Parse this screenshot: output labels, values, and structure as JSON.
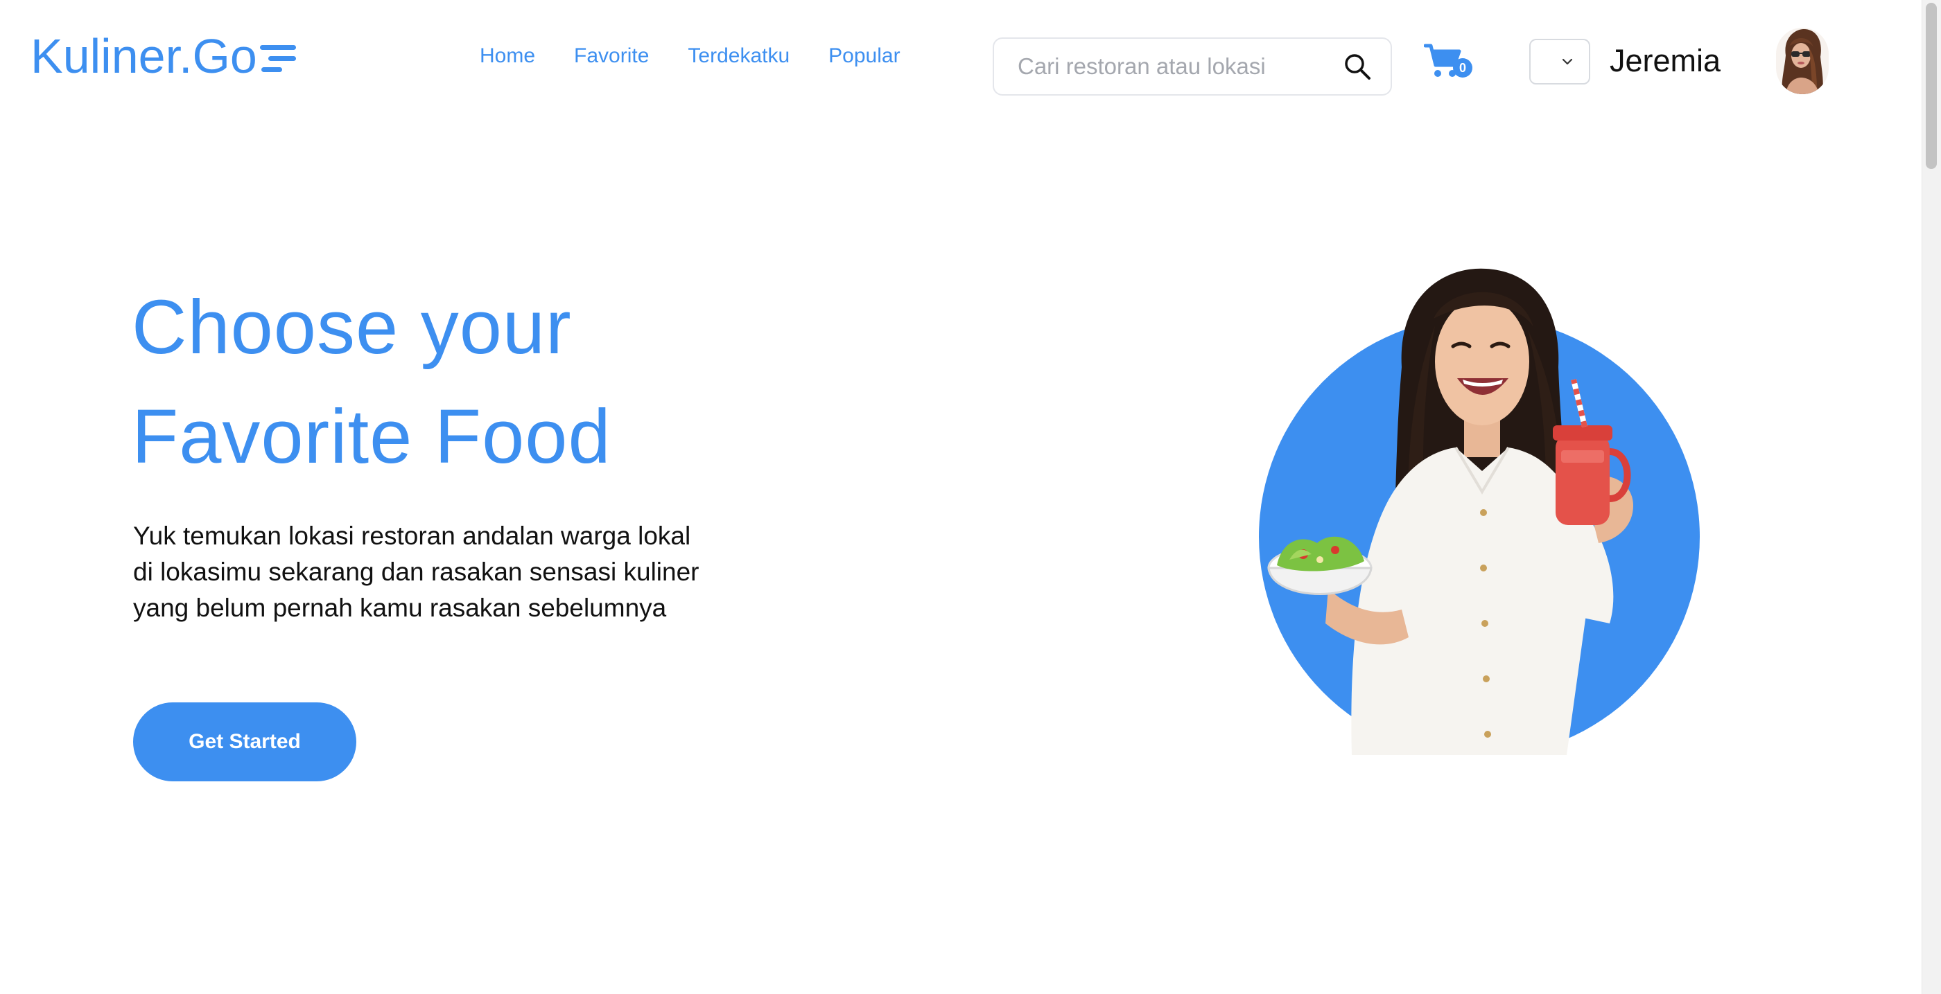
{
  "brand": {
    "logo_text": "Kuliner.Go",
    "accent_color": "#3d8ff0"
  },
  "nav": {
    "links": [
      {
        "label": "Home"
      },
      {
        "label": "Favorite"
      },
      {
        "label": "Terdekatku"
      },
      {
        "label": "Popular"
      }
    ]
  },
  "search": {
    "placeholder": "Cari restoran atau lokasi",
    "icon": "search-icon"
  },
  "cart": {
    "icon": "cart-icon",
    "count": "0"
  },
  "user": {
    "dropdown_icon": "chevron-down-icon",
    "name": "Jeremia",
    "avatar": "user-avatar"
  },
  "hero": {
    "title_lines": [
      "Choose your",
      "Favorite Food"
    ],
    "description_lines": [
      "Yuk temukan lokasi restoran andalan warga lokal",
      "di lokasimu sekarang dan rasakan sensasi kuliner",
      "yang belum pernah kamu rasakan sebelumnya"
    ],
    "cta_label": "Get Started",
    "image": "woman-holding-salad-and-juice"
  }
}
